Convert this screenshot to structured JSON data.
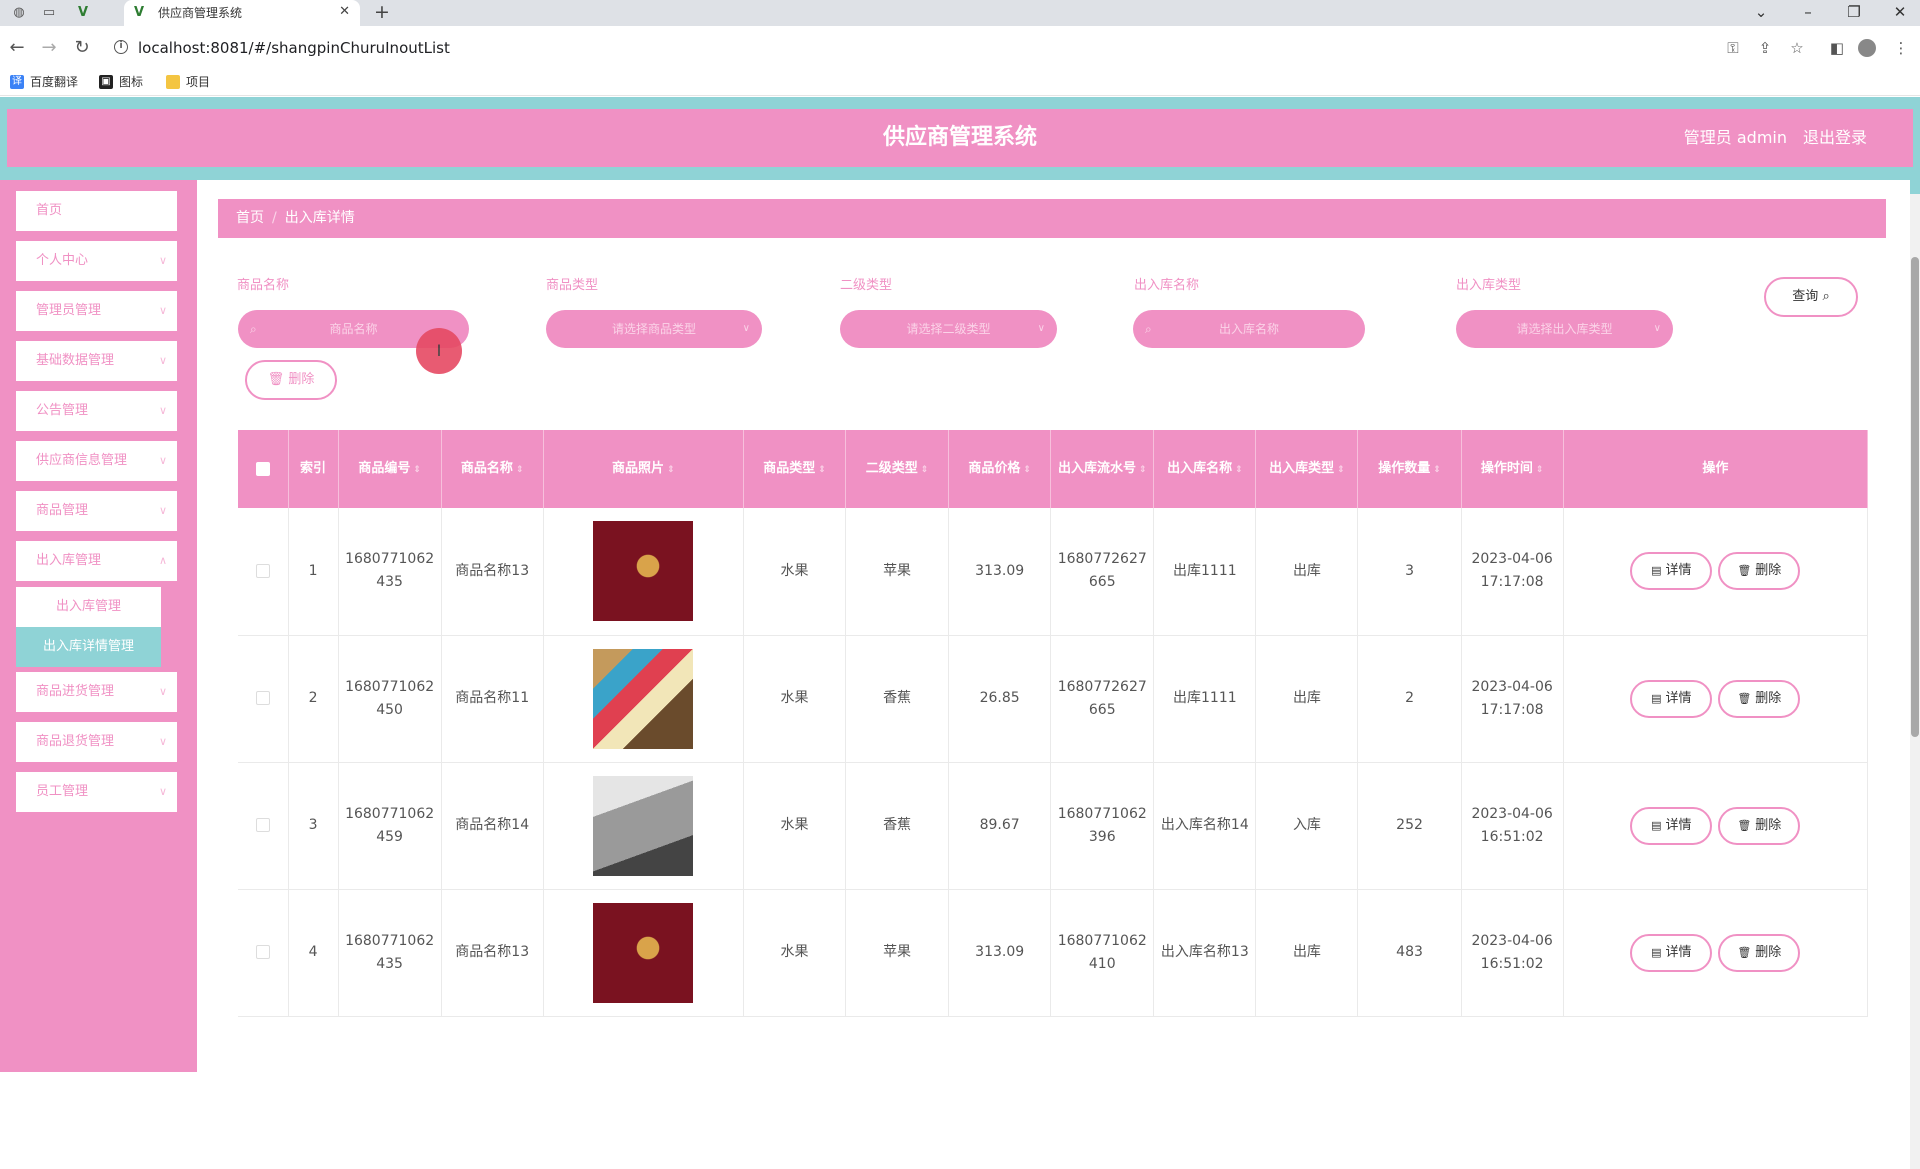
{
  "browser": {
    "tab_title": "供应商管理系统",
    "url": "localhost:8081/#/shangpinChuruInoutList",
    "bookmarks": [
      "百度翻译",
      "图标",
      "项目"
    ]
  },
  "header": {
    "title": "供应商管理系统",
    "user_label": "管理员 admin",
    "logout_label": "退出登录"
  },
  "sidebar": {
    "items": [
      {
        "label": "首页"
      },
      {
        "label": "个人中心"
      },
      {
        "label": "管理员管理"
      },
      {
        "label": "基础数据管理"
      },
      {
        "label": "公告管理"
      },
      {
        "label": "供应商信息管理"
      },
      {
        "label": "商品管理"
      },
      {
        "label": "出入库管理"
      },
      {
        "label": "商品进货管理"
      },
      {
        "label": "商品退货管理"
      },
      {
        "label": "员工管理"
      }
    ],
    "submenu": [
      "出入库管理",
      "出入库详情管理"
    ]
  },
  "breadcrumb": {
    "home": "首页",
    "current": "出入库详情"
  },
  "filters": {
    "f1": {
      "label": "商品名称",
      "placeholder": "商品名称"
    },
    "f2": {
      "label": "商品类型",
      "placeholder": "请选择商品类型"
    },
    "f3": {
      "label": "二级类型",
      "placeholder": "请选择二级类型"
    },
    "f4": {
      "label": "出入库名称",
      "placeholder": "出入库名称"
    },
    "f5": {
      "label": "出入库类型",
      "placeholder": "请选择出入库类型"
    },
    "query_label": "查询",
    "delete_label": "删除"
  },
  "table": {
    "headers": [
      "索引",
      "商品编号",
      "商品名称",
      "商品照片",
      "商品类型",
      "二级类型",
      "商品价格",
      "出入库流水号",
      "出入库名称",
      "出入库类型",
      "操作数量",
      "操作时间",
      "操作"
    ],
    "rows": [
      {
        "idx": "1",
        "code": "1680771062435",
        "name": "商品名称13",
        "type": "水果",
        "sub": "苹果",
        "price": "313.09",
        "serial": "1680772627665",
        "io_name": "出库1111",
        "io_type": "出库",
        "qty": "3",
        "time": "2023-04-06 17:17:08"
      },
      {
        "idx": "2",
        "code": "1680771062450",
        "name": "商品名称11",
        "type": "水果",
        "sub": "香蕉",
        "price": "26.85",
        "serial": "1680772627665",
        "io_name": "出库1111",
        "io_type": "出库",
        "qty": "2",
        "time": "2023-04-06 17:17:08"
      },
      {
        "idx": "3",
        "code": "1680771062459",
        "name": "商品名称14",
        "type": "水果",
        "sub": "香蕉",
        "price": "89.67",
        "serial": "1680771062396",
        "io_name": "出入库名称14",
        "io_type": "入库",
        "qty": "252",
        "time": "2023-04-06 16:51:02"
      },
      {
        "idx": "4",
        "code": "1680771062435",
        "name": "商品名称13",
        "type": "水果",
        "sub": "苹果",
        "price": "313.09",
        "serial": "1680771062410",
        "io_name": "出入库名称13",
        "io_type": "出库",
        "qty": "483",
        "time": "2023-04-06 16:51:02"
      }
    ],
    "detail_label": "详情",
    "delete_label": "删除"
  },
  "theme": {
    "primary": "#f091c4",
    "accent": "#8fd3d6"
  }
}
